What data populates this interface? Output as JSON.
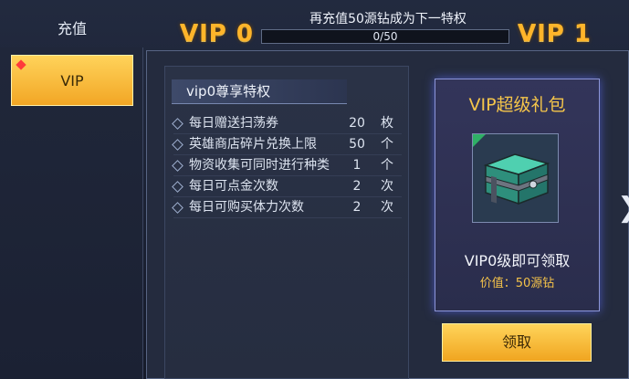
{
  "header": {
    "current_vip": "VIP 0",
    "next_vip": "VIP 1",
    "progress_title": "再充值50源钻成为下一特权",
    "progress_text": "0/50",
    "progress_fraction": 0
  },
  "sidebar": {
    "items": [
      {
        "label": "充值"
      },
      {
        "label": "VIP"
      }
    ]
  },
  "privileges": {
    "title": "vip0尊享特权",
    "rows": [
      {
        "label": "每日赠送扫荡券",
        "value": "20",
        "unit": "枚"
      },
      {
        "label": "英雄商店碎片兑换上限",
        "value": "50",
        "unit": "个"
      },
      {
        "label": "物资收集可同时进行种类",
        "value": "1",
        "unit": "个"
      },
      {
        "label": "每日可点金次数",
        "value": "2",
        "unit": "次"
      },
      {
        "label": "每日可购买体力次数",
        "value": "2",
        "unit": "次"
      }
    ]
  },
  "gift": {
    "title": "VIP超级礼包",
    "subtitle": "VIP0级即可领取",
    "price": "价值：50源钻",
    "claim_label": "领取"
  },
  "icons": {
    "next": "chevron-right-icon",
    "chest": "treasure-chest-icon"
  },
  "colors": {
    "accent_gold": "#f6c64a",
    "button_yellow": "#f2a625"
  }
}
